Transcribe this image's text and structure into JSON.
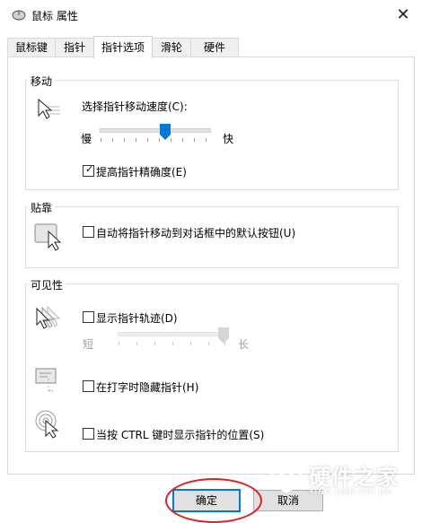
{
  "window": {
    "title": "鼠标 属性",
    "close_glyph": "✕"
  },
  "tabs": [
    {
      "label": "鼠标键",
      "active": false
    },
    {
      "label": "指针",
      "active": false
    },
    {
      "label": "指针选项",
      "active": true
    },
    {
      "label": "滑轮",
      "active": false
    },
    {
      "label": "硬件",
      "active": false
    }
  ],
  "motion": {
    "title": "移动",
    "speed_label": "选择指针移动速度(C):",
    "slow": "慢",
    "fast": "快",
    "speed_level": 0.6,
    "precision_label": "提高指针精确度(E)",
    "precision_checked": true,
    "check_glyph": "✓"
  },
  "snap": {
    "title": "贴靠",
    "label": "自动将指针移动到对话框中的默认按钮(U)",
    "checked": false
  },
  "visibility": {
    "title": "可见性",
    "trails_label": "显示指针轨迹(D)",
    "trails_checked": false,
    "short": "短",
    "long": "长",
    "trails_level": 1.0,
    "hide_label": "在打字时隐藏指针(H)",
    "hide_checked": false,
    "ctrl_label": "当按 CTRL 键时显示指针的位置(S)",
    "ctrl_checked": false
  },
  "buttons": {
    "ok": "确定",
    "cancel": "取消"
  },
  "watermark": {
    "main": "硬件之家",
    "sub": "YING JIAN ZHI JIA"
  },
  "colors": {
    "accent": "#0078d7",
    "annotation": "#e02020"
  }
}
